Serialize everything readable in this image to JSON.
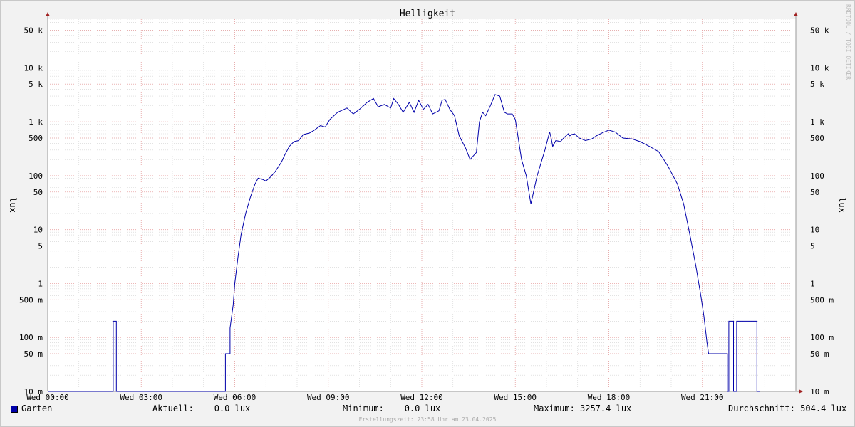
{
  "chart_data": {
    "type": "line",
    "title": "Helligkeit",
    "ylabel": "lux",
    "yscale": "log",
    "ylim": [
      0.01,
      80000
    ],
    "xlim": [
      "Wed 00:00",
      "Thu 00:00"
    ],
    "x_ticks": [
      "Wed 00:00",
      "Wed 03:00",
      "Wed 06:00",
      "Wed 09:00",
      "Wed 12:00",
      "Wed 15:00",
      "Wed 18:00",
      "Wed 21:00"
    ],
    "y_ticks": [
      {
        "value": 0.01,
        "label": "10 m"
      },
      {
        "value": 0.05,
        "label": "50 m"
      },
      {
        "value": 0.1,
        "label": "100 m"
      },
      {
        "value": 0.5,
        "label": "500 m"
      },
      {
        "value": 1,
        "label": "1"
      },
      {
        "value": 5,
        "label": "5"
      },
      {
        "value": 10,
        "label": "10"
      },
      {
        "value": 50,
        "label": "50"
      },
      {
        "value": 100,
        "label": "100"
      },
      {
        "value": 500,
        "label": "500"
      },
      {
        "value": 1000,
        "label": "1 k"
      },
      {
        "value": 5000,
        "label": "5 k"
      },
      {
        "value": 10000,
        "label": "10 k"
      },
      {
        "value": 50000,
        "label": "50 k"
      }
    ],
    "series": [
      {
        "name": "Garten",
        "color": "#0000aa",
        "x_hours": [
          0,
          2.1,
          2.1,
          2.2,
          2.2,
          5.7,
          5.7,
          5.85,
          5.85,
          5.95,
          6.0,
          6.1,
          6.2,
          6.35,
          6.5,
          6.65,
          6.75,
          6.9,
          7.0,
          7.15,
          7.3,
          7.5,
          7.6,
          7.75,
          7.9,
          8.05,
          8.2,
          8.4,
          8.55,
          8.75,
          8.9,
          9.05,
          9.3,
          9.6,
          9.8,
          10.0,
          10.25,
          10.45,
          10.6,
          10.8,
          11.0,
          11.1,
          11.25,
          11.4,
          11.6,
          11.75,
          11.9,
          12.05,
          12.2,
          12.35,
          12.55,
          12.65,
          12.75,
          12.9,
          13.05,
          13.2,
          13.4,
          13.55,
          13.75,
          13.85,
          13.95,
          14.05,
          14.2,
          14.35,
          14.5,
          14.65,
          14.75,
          14.9,
          15.0,
          15.2,
          15.35,
          15.5,
          15.7,
          15.95,
          16.1,
          16.15,
          16.2,
          16.3,
          16.45,
          16.55,
          16.7,
          16.75,
          16.8,
          16.9,
          17.05,
          17.25,
          17.45,
          17.6,
          17.8,
          18.0,
          18.2,
          18.45,
          18.75,
          19.0,
          19.3,
          19.6,
          19.9,
          20.2,
          20.4,
          20.6,
          20.8,
          20.95,
          21.05,
          21.15,
          21.2,
          21.25,
          21.3,
          21.4,
          21.5,
          21.6,
          21.8,
          21.8,
          21.85,
          21.85,
          22.0,
          22.0,
          22.1,
          22.1,
          22.75,
          22.75,
          22.85,
          22.85,
          24.0
        ],
        "values": [
          0.01,
          0.01,
          0.2,
          0.2,
          0.01,
          0.01,
          0.05,
          0.05,
          0.15,
          0.4,
          1.0,
          3.0,
          8.0,
          20.0,
          40.0,
          70.0,
          90.0,
          85.0,
          80.0,
          95.0,
          120.0,
          180.0,
          240.0,
          350.0,
          430.0,
          450.0,
          580.0,
          620.0,
          700.0,
          850.0,
          800.0,
          1100.0,
          1500.0,
          1800.0,
          1400.0,
          1700.0,
          2300.0,
          2700.0,
          1900.0,
          2100.0,
          1800.0,
          2700.0,
          2100.0,
          1500.0,
          2300.0,
          1500.0,
          2500.0,
          1700.0,
          2100.0,
          1400.0,
          1600.0,
          2500.0,
          2600.0,
          1700.0,
          1300.0,
          550.0,
          330.0,
          200.0,
          270.0,
          1000.0,
          1500.0,
          1300.0,
          2000.0,
          3200.0,
          3000.0,
          1500.0,
          1400.0,
          1400.0,
          1100.0,
          200.0,
          100.0,
          30.0,
          100.0,
          300.0,
          650.0,
          500.0,
          350.0,
          450.0,
          430.0,
          500.0,
          600.0,
          550.0,
          580.0,
          600.0,
          500.0,
          450.0,
          480.0,
          550.0,
          630.0,
          700.0,
          650.0,
          500.0,
          480.0,
          430.0,
          350.0,
          280.0,
          150.0,
          70.0,
          30.0,
          8.0,
          2.0,
          0.6,
          0.25,
          0.08,
          0.05,
          0.05,
          0.05,
          0.05,
          0.05,
          0.05,
          0.05,
          0.01,
          0.01,
          0.2,
          0.2,
          0.01,
          0.01,
          0.2,
          0.2,
          0.01,
          0.01
        ]
      }
    ],
    "grid": true,
    "legend": "bottom-left"
  },
  "legend": {
    "series_name": "Garten",
    "current": "Aktuell:    0.0 lux",
    "minimum": "Minimum:    0.0 lux",
    "maximum": "Maximum: 3257.4 lux",
    "average": "Durchschnitt: 504.4 lux"
  },
  "footer": "Erstellungszeit: 23:58 Uhr am 23.04.2025",
  "watermark": "RRDTOOL / TOBI OETIKER",
  "colors": {
    "line": "#0000aa",
    "major_grid": "#e8a0a0",
    "minor_grid": "#d0d0d0",
    "axis": "#999999",
    "arrow": "#a02020"
  }
}
